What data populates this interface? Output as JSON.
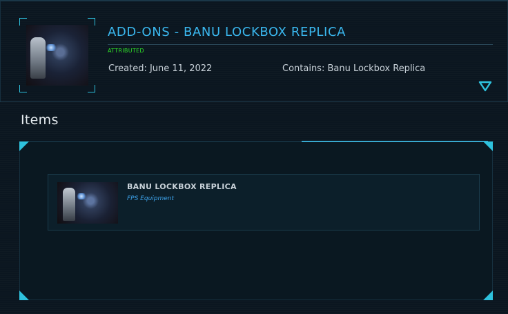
{
  "header": {
    "title": "ADD-ONS - BANU LOCKBOX REPLICA",
    "badge": "ATTRIBUTED",
    "created": "Created: June 11, 2022",
    "contains": "Contains: Banu Lockbox Replica",
    "thumbnail_icon": "lockbox-thumbnail-image",
    "expand_icon": "triangle-down-icon"
  },
  "items_section": {
    "label": "Items",
    "items": [
      {
        "name": "BANU LOCKBOX REPLICA",
        "category": "FPS Equipment",
        "thumbnail_icon": "item-thumbnail-image"
      }
    ]
  },
  "colors": {
    "title": "#3ab7ee",
    "badge": "#2fe028",
    "accent": "#2ec2de",
    "category": "#3ea5ee",
    "background": "#0b1620"
  }
}
